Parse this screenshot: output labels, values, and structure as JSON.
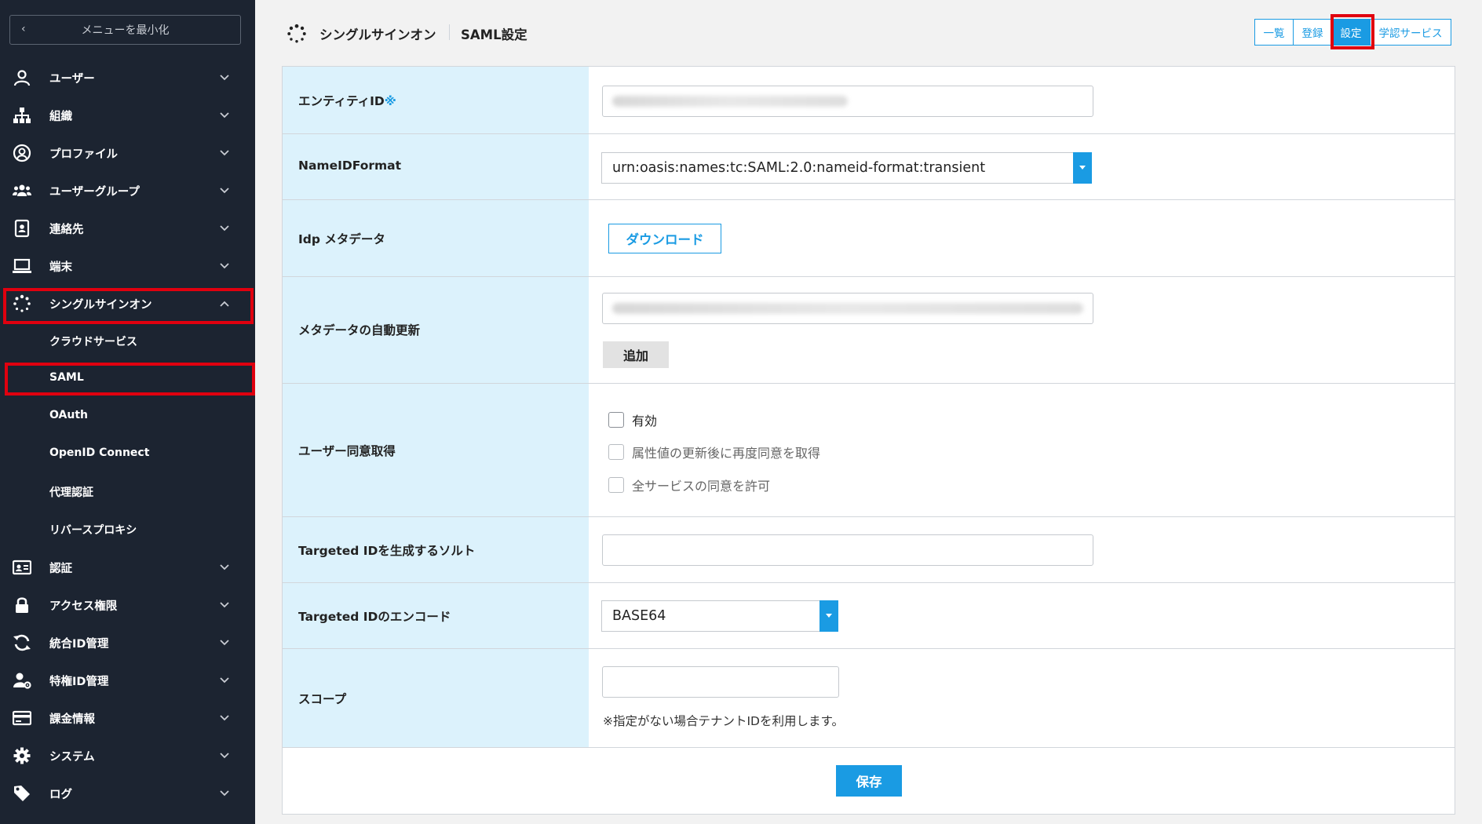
{
  "sidebar": {
    "minimize_label": "メニューを最小化",
    "items": [
      {
        "label": "ユーザー",
        "icon": "user-icon"
      },
      {
        "label": "組織",
        "icon": "org-chart-icon"
      },
      {
        "label": "プロファイル",
        "icon": "profile-icon"
      },
      {
        "label": "ユーザーグループ",
        "icon": "user-group-icon"
      },
      {
        "label": "連絡先",
        "icon": "contact-book-icon"
      },
      {
        "label": "端末",
        "icon": "laptop-icon"
      },
      {
        "label": "シングルサインオン",
        "icon": "sso-icon"
      },
      {
        "label": "認証",
        "icon": "id-card-icon"
      },
      {
        "label": "アクセス権限",
        "icon": "lock-icon"
      },
      {
        "label": "統合ID管理",
        "icon": "sync-icon"
      },
      {
        "label": "特権ID管理",
        "icon": "user-gear-icon"
      },
      {
        "label": "課金情報",
        "icon": "credit-card-icon"
      },
      {
        "label": "システム",
        "icon": "gear-icon"
      },
      {
        "label": "ログ",
        "icon": "tag-icon"
      }
    ],
    "sso_subitems": [
      {
        "label": "クラウドサービス"
      },
      {
        "label": "SAML"
      },
      {
        "label": "OAuth"
      },
      {
        "label": "OpenID Connect"
      },
      {
        "label": "代理認証"
      },
      {
        "label": "リバースプロキシ"
      }
    ]
  },
  "header": {
    "section": "シングルサインオン",
    "page": "SAML設定",
    "tabs": [
      {
        "label": "一覧"
      },
      {
        "label": "登録"
      },
      {
        "label": "設定",
        "active": true
      },
      {
        "label": "学認サービス"
      }
    ]
  },
  "form": {
    "entity_id": {
      "label": "エンティティID",
      "required_mark": "※"
    },
    "nameid_format": {
      "label": "NameIDFormat",
      "value": "urn:oasis:names:tc:SAML:2.0:nameid-format:transient"
    },
    "idp_metadata": {
      "label": "Idp メタデータ",
      "button": "ダウンロード"
    },
    "metadata_auto_update": {
      "label": "メタデータの自動更新",
      "add_button": "追加"
    },
    "user_consent": {
      "label": "ユーザー同意取得",
      "options": [
        {
          "label": "有効",
          "checked": false,
          "enabled": true
        },
        {
          "label": "属性値の更新後に再度同意を取得",
          "checked": false,
          "enabled": false
        },
        {
          "label": "全サービスの同意を許可",
          "checked": false,
          "enabled": false
        }
      ]
    },
    "targeted_id_salt": {
      "label": "Targeted IDを生成するソルト",
      "value": ""
    },
    "targeted_id_encode": {
      "label": "Targeted IDのエンコード",
      "value": "BASE64"
    },
    "scope": {
      "label": "スコープ",
      "value": "",
      "note": "※指定がない場合テナントIDを利用します。"
    },
    "save_label": "保存"
  },
  "colors": {
    "accent": "#1a9be3",
    "sidebar_bg": "#1c2431",
    "label_bg": "#dcf2fc",
    "highlight": "#e0000f"
  }
}
